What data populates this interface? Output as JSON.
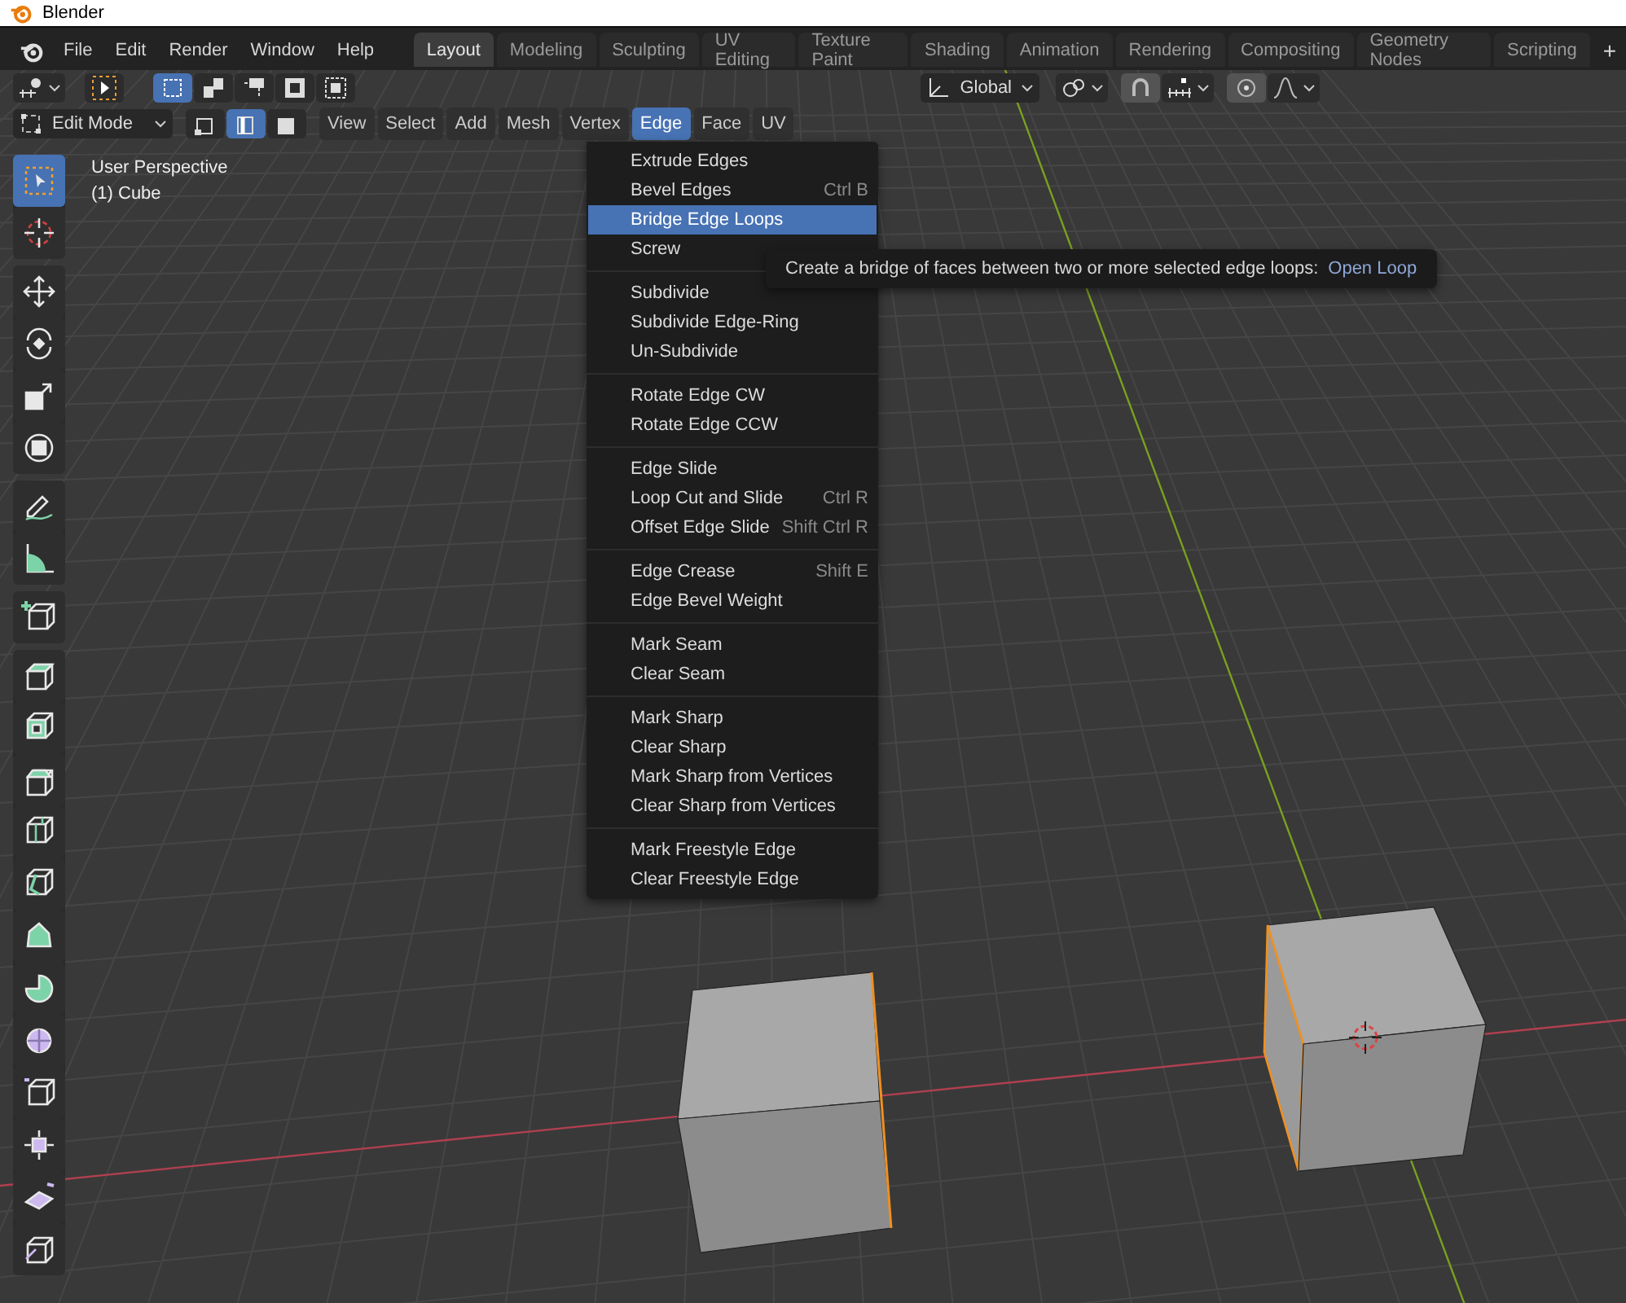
{
  "window": {
    "title": "Blender"
  },
  "menubar": {
    "items": [
      "File",
      "Edit",
      "Render",
      "Window",
      "Help"
    ]
  },
  "workspace_tabs": [
    {
      "label": "Layout",
      "selected": true
    },
    {
      "label": "Modeling",
      "selected": false
    },
    {
      "label": "Sculpting",
      "selected": false
    },
    {
      "label": "UV Editing",
      "selected": false
    },
    {
      "label": "Texture Paint",
      "selected": false
    },
    {
      "label": "Shading",
      "selected": false
    },
    {
      "label": "Animation",
      "selected": false
    },
    {
      "label": "Rendering",
      "selected": false
    },
    {
      "label": "Compositing",
      "selected": false
    },
    {
      "label": "Geometry Nodes",
      "selected": false
    },
    {
      "label": "Scripting",
      "selected": false
    }
  ],
  "add_tab_button": "+",
  "tool_settings": {
    "select_modes": [
      {
        "kind": "set",
        "selected": true
      },
      {
        "kind": "extend",
        "selected": false
      },
      {
        "kind": "subtract",
        "selected": false
      },
      {
        "kind": "invert",
        "selected": false
      },
      {
        "kind": "intersect",
        "selected": false
      }
    ],
    "orientation": "Global"
  },
  "header": {
    "mode": "Edit Mode",
    "element_modes": [
      {
        "kind": "vertex",
        "selected": false
      },
      {
        "kind": "edge",
        "selected": true
      },
      {
        "kind": "face",
        "selected": false
      }
    ],
    "menus": [
      {
        "label": "View",
        "selected": false
      },
      {
        "label": "Select",
        "selected": false
      },
      {
        "label": "Add",
        "selected": false
      },
      {
        "label": "Mesh",
        "selected": false
      },
      {
        "label": "Vertex",
        "selected": false
      },
      {
        "label": "Edge",
        "selected": true
      },
      {
        "label": "Face",
        "selected": false
      },
      {
        "label": "UV",
        "selected": false
      }
    ]
  },
  "viewport": {
    "view_name": "User Perspective",
    "object_name": "(1) Cube"
  },
  "toolbar": [
    [
      {
        "kind": "select_box",
        "selected": true
      },
      {
        "kind": "cursor",
        "selected": false
      }
    ],
    [
      {
        "kind": "move",
        "selected": false
      },
      {
        "kind": "rotate",
        "selected": false
      },
      {
        "kind": "scale",
        "selected": false
      },
      {
        "kind": "transform",
        "selected": false
      }
    ],
    [
      {
        "kind": "annotate",
        "selected": false
      },
      {
        "kind": "measure",
        "selected": false
      }
    ],
    [
      {
        "kind": "add_cube",
        "selected": false
      }
    ],
    [
      {
        "kind": "extrude",
        "selected": false
      },
      {
        "kind": "inset",
        "selected": false
      },
      {
        "kind": "bevel",
        "selected": false
      },
      {
        "kind": "loop_cut",
        "selected": false
      },
      {
        "kind": "knife",
        "selected": false
      },
      {
        "kind": "poly_build",
        "selected": false
      },
      {
        "kind": "spin",
        "selected": false
      },
      {
        "kind": "smooth",
        "selected": false
      },
      {
        "kind": "edge_slide",
        "selected": false
      },
      {
        "kind": "shrink",
        "selected": false
      },
      {
        "kind": "shear",
        "selected": false
      },
      {
        "kind": "rip",
        "selected": false
      }
    ]
  ],
  "edge_menu": {
    "groups": [
      [
        {
          "label": "Extrude Edges",
          "selected": false
        },
        {
          "label": "Bevel Edges",
          "shortcut": "Ctrl B",
          "selected": false
        },
        {
          "label": "Bridge Edge Loops",
          "selected": true
        },
        {
          "label": "Screw",
          "selected": false
        }
      ],
      [
        {
          "label": "Subdivide",
          "selected": false
        },
        {
          "label": "Subdivide Edge-Ring",
          "selected": false
        },
        {
          "label": "Un-Subdivide",
          "selected": false
        }
      ],
      [
        {
          "label": "Rotate Edge CW",
          "selected": false
        },
        {
          "label": "Rotate Edge CCW",
          "selected": false
        }
      ],
      [
        {
          "label": "Edge Slide",
          "selected": false
        },
        {
          "label": "Loop Cut and Slide",
          "shortcut": "Ctrl R",
          "selected": false
        },
        {
          "label": "Offset Edge Slide",
          "shortcut": "Shift Ctrl R",
          "selected": false
        }
      ],
      [
        {
          "label": "Edge Crease",
          "shortcut": "Shift E",
          "selected": false
        },
        {
          "label": "Edge Bevel Weight",
          "selected": false
        }
      ],
      [
        {
          "label": "Mark Seam",
          "selected": false
        },
        {
          "label": "Clear Seam",
          "selected": false
        }
      ],
      [
        {
          "label": "Mark Sharp",
          "selected": false
        },
        {
          "label": "Clear Sharp",
          "selected": false
        },
        {
          "label": "Mark Sharp from Vertices",
          "selected": false
        },
        {
          "label": "Clear Sharp from Vertices",
          "selected": false
        }
      ],
      [
        {
          "label": "Mark Freestyle Edge",
          "selected": false
        },
        {
          "label": "Clear Freestyle Edge",
          "selected": false
        }
      ]
    ]
  },
  "tooltip": {
    "text": "Create a bridge of faces between two or more selected edge loops:",
    "hint": "Open Loop"
  }
}
